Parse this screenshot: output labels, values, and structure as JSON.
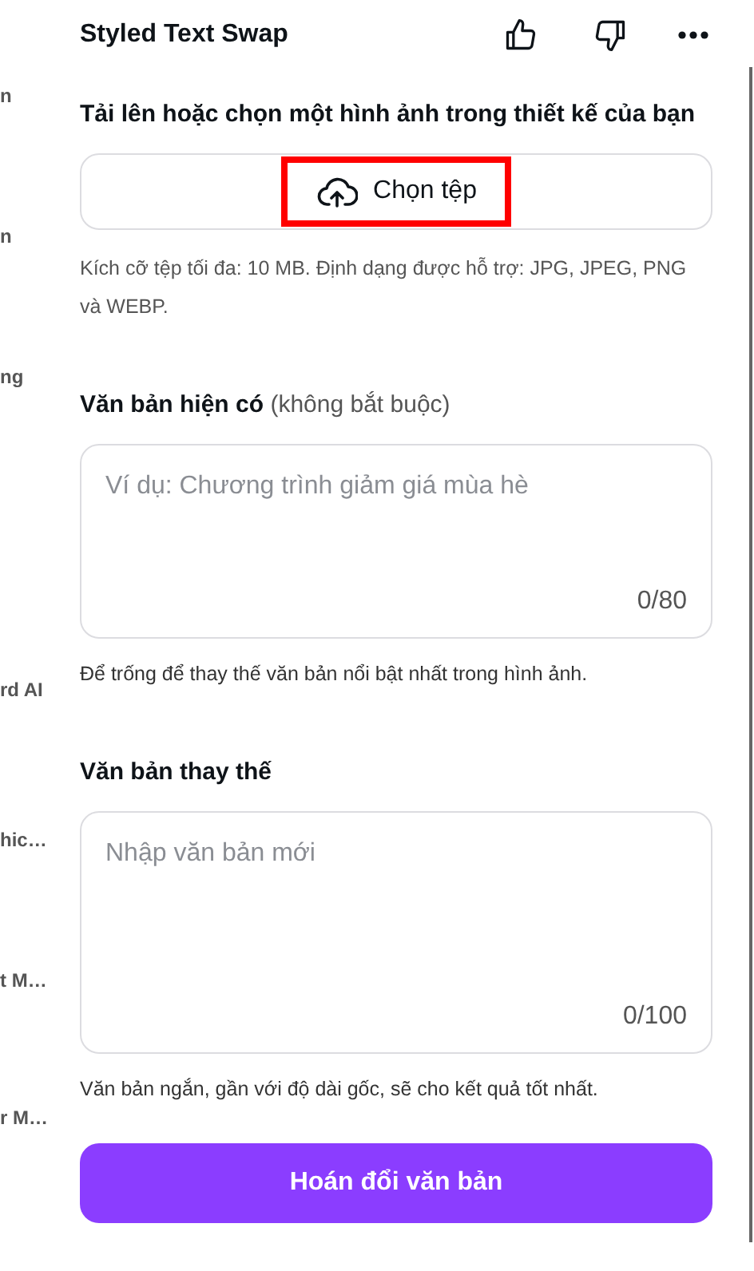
{
  "sidebar": {
    "items": [
      {
        "label": "n"
      },
      {
        "label": "n"
      },
      {
        "label": "ng"
      },
      {
        "label": "rd AI"
      },
      {
        "label": "hic…"
      },
      {
        "label": "t M…"
      },
      {
        "label": "r M…"
      }
    ]
  },
  "header": {
    "title": "Styled Text Swap"
  },
  "upload": {
    "label": "Tải lên hoặc chọn một hình ảnh trong thiết kế của bạn",
    "button": "Chọn tệp",
    "highlighted": true,
    "help": "Kích cỡ tệp tối đa: 10 MB. Định dạng được hỗ trợ: JPG, JPEG, PNG và WEBP."
  },
  "fields": [
    {
      "label": "Văn bản hiện có",
      "optional": "(không bắt buộc)",
      "placeholder": "Ví dụ: Chương trình giảm giá mùa hè",
      "counter": "0/80",
      "hint": "Để trống để thay thế văn bản nổi bật nhất trong hình ảnh."
    },
    {
      "label": "Văn bản thay thế",
      "placeholder": "Nhập văn bản mới",
      "counter": "0/100",
      "hint": "Văn bản ngắn, gần với độ dài gốc, sẽ cho kết quả tốt nhất."
    }
  ],
  "submit": "Hoán đổi văn bản"
}
